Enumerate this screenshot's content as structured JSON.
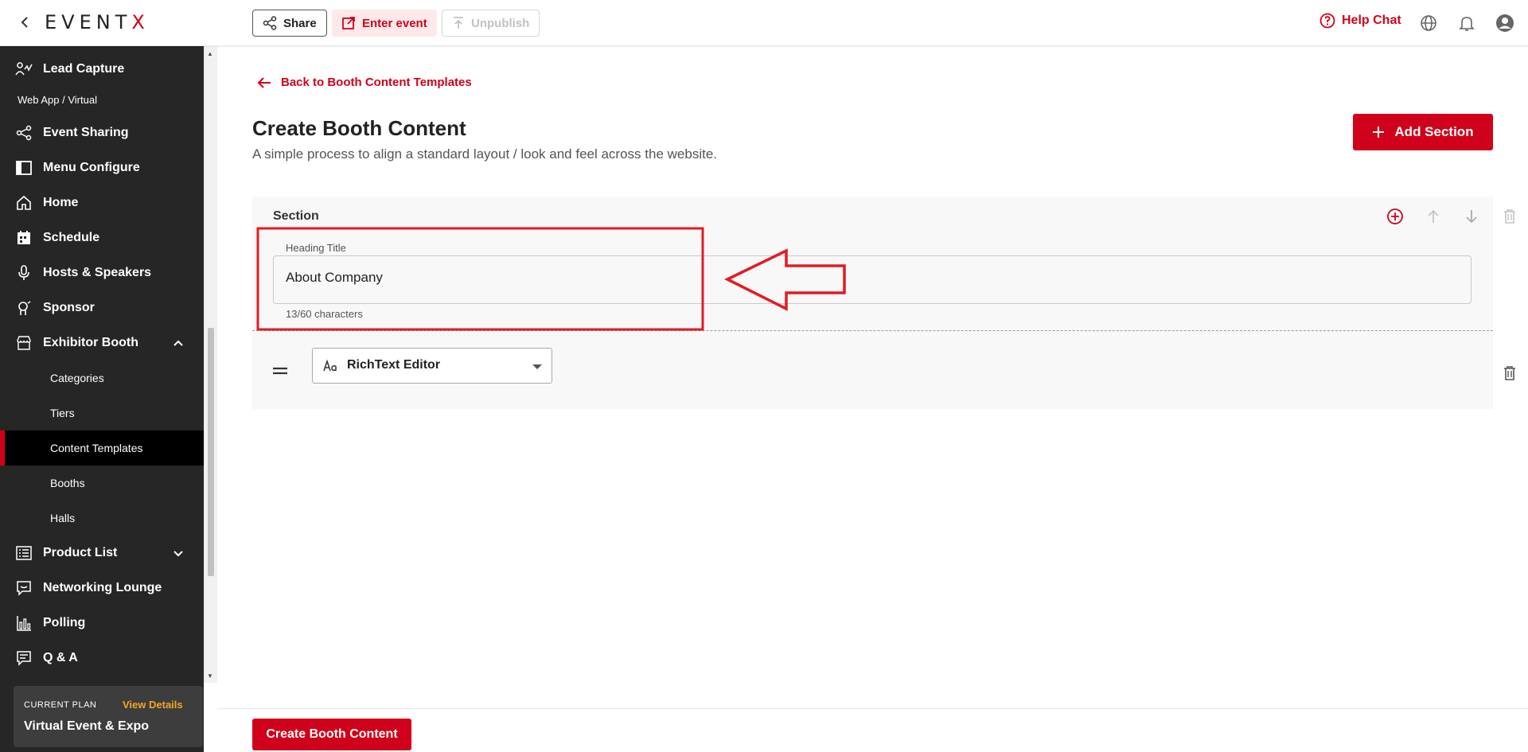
{
  "header": {
    "logo_prefix": "EVENT",
    "logo_suffix": "X",
    "share_label": "Share",
    "enter_event_label": "Enter event",
    "unpublish_label": "Unpublish",
    "help_chat_label": "Help Chat"
  },
  "sidebar": {
    "lead_capture": "Lead Capture",
    "section_web_app": "Web App / Virtual",
    "event_sharing": "Event Sharing",
    "menu_configure": "Menu Configure",
    "home": "Home",
    "schedule": "Schedule",
    "hosts_speakers": "Hosts & Speakers",
    "sponsor": "Sponsor",
    "exhibitor_booth": "Exhibitor Booth",
    "sub": {
      "categories": "Categories",
      "tiers": "Tiers",
      "content_templates": "Content Templates",
      "booths": "Booths",
      "halls": "Halls"
    },
    "product_list": "Product List",
    "networking_lounge": "Networking Lounge",
    "polling": "Polling",
    "qa": "Q & A",
    "plan": {
      "caption": "CURRENT PLAN",
      "view_details": "View Details",
      "name": "Virtual Event & Expo"
    }
  },
  "main": {
    "back_link": "Back to Booth Content Templates",
    "title": "Create Booth Content",
    "subtitle": "A simple process to align a standard layout / look and feel across the website.",
    "add_section_label": "Add Section",
    "section": {
      "title": "Section",
      "heading_field_label": "Heading Title",
      "heading_value": "About Company",
      "char_counter": "13/60 characters",
      "component_type": "RichText Editor"
    }
  },
  "footer": {
    "create_label": "Create Booth Content"
  },
  "colors": {
    "accent": "#d0021b",
    "sidebar_bg": "#262626",
    "plan_link": "#f5a623"
  }
}
